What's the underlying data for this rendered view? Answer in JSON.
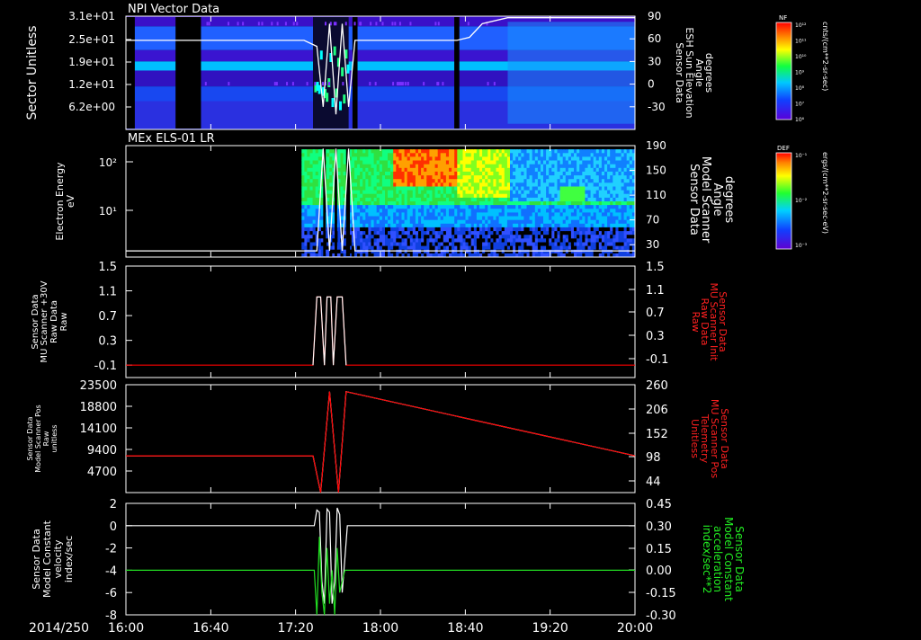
{
  "chart_data": [
    {
      "type": "heatmap",
      "title": "NPI Vector Data",
      "ylabel": "Sector Unitless",
      "yticks": [
        "3.1e+01",
        "2.5e+01",
        "1.9e+01",
        "1.2e+01",
        "6.2e+00"
      ],
      "right_axis": {
        "label": [
          "Sensor Data",
          "ESH Sun Elevation",
          "Angle",
          "degrees"
        ],
        "ticks": [
          "90",
          "60",
          "30",
          "0",
          "-30"
        ],
        "ylim": [
          -60,
          90
        ]
      },
      "colorbar": {
        "name": "NF",
        "unit": "cnts/(cm**2-sr-sec)",
        "ticks": [
          "10¹²",
          "10¹¹",
          "10¹⁰",
          "10⁹",
          "10⁸",
          "10⁷",
          "10⁶"
        ]
      },
      "series": [
        {
          "x_hours": [
            16.0,
            16.1,
            16.2,
            16.3,
            16.4,
            16.5,
            16.6,
            16.7,
            16.8,
            16.9,
            17.0,
            17.1,
            17.2,
            17.3,
            17.4,
            17.5,
            17.55,
            17.6,
            17.65,
            17.7,
            17.75,
            17.8,
            18.0,
            18.5,
            18.6,
            18.7,
            18.8,
            19.0,
            19.5,
            20.0
          ],
          "values": [
            58,
            58,
            58,
            58,
            58,
            58,
            58,
            58,
            58,
            58,
            58,
            58,
            58,
            58,
            58,
            50,
            -30,
            80,
            -40,
            80,
            -30,
            58,
            58,
            58,
            58,
            62,
            80,
            88,
            88,
            88
          ]
        }
      ]
    },
    {
      "type": "heatmap",
      "title": "MEx ELS-01 LR",
      "ylabel": [
        "Electron Energy",
        "eV"
      ],
      "yticks": [
        "10²",
        "10¹"
      ],
      "right_axis": {
        "label": [
          "Sensor Data",
          "Model Scanner",
          "Angle",
          "degrees"
        ],
        "ticks": [
          "190",
          "150",
          "110",
          "70",
          "30"
        ],
        "ylim": [
          10,
          190
        ]
      },
      "colorbar": {
        "name": "DEF",
        "unit": "ergs/(cm**2-sr-sec-eV)",
        "ticks": [
          "10⁻¹",
          "10⁻²",
          "10⁻³"
        ]
      },
      "series": [
        {
          "x_hours": [
            16.0,
            17.5,
            17.55,
            17.6,
            17.65,
            17.7,
            17.75,
            17.8,
            20.0
          ],
          "values": [
            20,
            20,
            185,
            20,
            185,
            20,
            185,
            20,
            20
          ]
        }
      ]
    },
    {
      "type": "line",
      "ylabel": [
        "Sensor Data",
        "MU Scanner +30V",
        "Raw Data",
        "Raw"
      ],
      "ylim": [
        -0.3,
        1.5
      ],
      "yticks": [
        "1.5",
        "1.1",
        "0.7",
        "0.3",
        "-0.1"
      ],
      "right_axis": {
        "label": [
          "Sensor Data",
          "MU Scanner Init",
          "Raw Data",
          "Raw"
        ],
        "ticks": [
          "1.5",
          "1.1",
          "0.7",
          "0.3",
          "-0.1"
        ],
        "color": "#ff2020"
      },
      "series": [
        {
          "color": "#ff0000",
          "x_hours": [
            16.0,
            17.47,
            17.5,
            17.53,
            17.56,
            17.58,
            17.61,
            17.63,
            17.66,
            17.7,
            17.73,
            20.0
          ],
          "values": [
            -0.1,
            -0.1,
            1.0,
            1.0,
            -0.1,
            1.0,
            1.0,
            -0.1,
            1.0,
            1.0,
            -0.1,
            -0.1
          ]
        },
        {
          "color": "#ffffff",
          "x_hours": [
            17.47,
            17.5,
            17.53,
            17.56,
            17.58,
            17.61,
            17.63,
            17.66,
            17.7,
            17.73
          ],
          "values": [
            -0.1,
            1.0,
            1.0,
            -0.1,
            1.0,
            1.0,
            -0.1,
            1.0,
            1.0,
            -0.1
          ]
        }
      ]
    },
    {
      "type": "line",
      "ylabel": [
        "Sensor Data",
        "Model Scanner Pos",
        "Raw",
        "unitless"
      ],
      "ylim": [
        0,
        23500
      ],
      "yticks": [
        "23500",
        "18800",
        "14100",
        "9400",
        "4700"
      ],
      "right_axis": {
        "label": [
          "Sensor Data",
          "MU Scanner Pos",
          "Telemetry",
          "Unitless"
        ],
        "ticks": [
          "260",
          "206",
          "152",
          "98",
          "44"
        ],
        "color": "#ff2020"
      },
      "series": [
        {
          "color": "#ffffff",
          "x_hours": [
            16.0,
            17.47,
            17.53,
            17.6,
            17.67,
            17.73,
            20.0
          ],
          "values": [
            8000,
            8000,
            0,
            22000,
            0,
            22000,
            8000
          ]
        },
        {
          "color": "#ff0000",
          "x_hours": [
            16.0,
            17.47,
            17.53,
            17.6,
            17.67,
            17.73,
            20.0
          ],
          "values": [
            8000,
            8000,
            0,
            22000,
            0,
            22000,
            8000
          ]
        }
      ]
    },
    {
      "type": "line",
      "ylabel": [
        "Sensor Data",
        "Model Constant",
        "velocity",
        "index/sec"
      ],
      "ylim": [
        -8,
        2
      ],
      "yticks": [
        "2",
        "0",
        "-2",
        "-4",
        "-6",
        "-8"
      ],
      "right_axis": {
        "label": [
          "Sensor Data",
          "Model Constant",
          "acceleration",
          "index/sec**2"
        ],
        "ticks": [
          "0.45",
          "0.30",
          "0.15",
          "0.00",
          "-0.15",
          "-0.30"
        ],
        "color": "#22ee22"
      },
      "xlabel": "2014/250",
      "xticks": [
        "16:00",
        "16:40",
        "17:20",
        "18:00",
        "18:40",
        "19:20",
        "20:00"
      ],
      "series": [
        {
          "color": "#ffffff",
          "x_hours": [
            16.0,
            17.48,
            17.5,
            17.52,
            17.54,
            17.56,
            17.58,
            17.6,
            17.62,
            17.64,
            17.66,
            17.68,
            17.7,
            17.72,
            17.74,
            20.0
          ],
          "values": [
            0,
            0,
            1.4,
            1.2,
            -5,
            -7,
            1.5,
            1.2,
            -7,
            -5,
            1.6,
            1.0,
            -6,
            -3,
            0,
            0
          ]
        },
        {
          "color": "#22dd22",
          "x_hours": [
            16.0,
            17.48,
            17.5,
            17.52,
            17.54,
            17.56,
            17.58,
            17.6,
            17.62,
            17.64,
            17.66,
            17.68,
            17.7,
            17.72,
            17.74,
            20.0
          ],
          "values": [
            -4,
            -4,
            -8,
            -1,
            -6,
            -8,
            -2,
            -7,
            -4,
            -8,
            -2,
            -6,
            -5,
            -4,
            -4,
            -4
          ]
        }
      ]
    }
  ],
  "colors": {
    "background": "#000000",
    "axis": "#ffffff",
    "red_axis": "#ff2020",
    "green_axis": "#22ee22"
  }
}
